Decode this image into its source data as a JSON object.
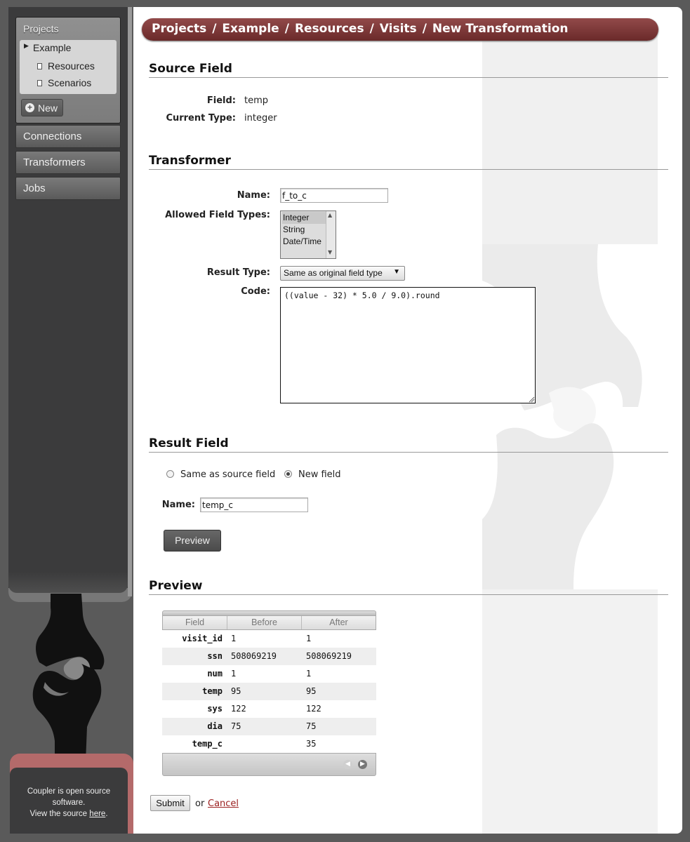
{
  "sidebar": {
    "projects_heading": "Projects",
    "tree": {
      "project": "Example",
      "children": [
        "Resources",
        "Scenarios"
      ]
    },
    "new_button": "New",
    "nav": [
      "Connections",
      "Transformers",
      "Jobs"
    ]
  },
  "footer": {
    "line1": "Coupler is open source",
    "line2": "software.",
    "line3_prefix": "View the source",
    "link": "here",
    "line3_suffix": "."
  },
  "breadcrumb": [
    "Projects",
    "Example",
    "Resources",
    "Visits",
    "New Transformation"
  ],
  "breadcrumb_separator": "/",
  "source_field": {
    "title": "Source Field",
    "field_label": "Field:",
    "field_value": "temp",
    "type_label": "Current Type:",
    "type_value": "integer"
  },
  "transformer": {
    "title": "Transformer",
    "name_label": "Name:",
    "name_value": "f_to_c",
    "allowed_label": "Allowed Field Types:",
    "allowed_options": [
      "Integer",
      "String",
      "Date/Time"
    ],
    "result_type_label": "Result Type:",
    "result_type_value": "Same as original field type",
    "code_label": "Code:",
    "code_value": "((value - 32) * 5.0 / 9.0).round"
  },
  "result_field": {
    "title": "Result Field",
    "radio_same": "Same as source field",
    "radio_new": "New field",
    "selected": "New field",
    "name_label": "Name:",
    "name_value": "temp_c",
    "preview_button": "Preview"
  },
  "preview": {
    "title": "Preview",
    "columns": [
      "Field",
      "Before",
      "After"
    ],
    "rows": [
      {
        "field": "visit_id",
        "before": "1",
        "after": "1"
      },
      {
        "field": "ssn",
        "before": "508069219",
        "after": "508069219"
      },
      {
        "field": "num",
        "before": "1",
        "after": "1"
      },
      {
        "field": "temp",
        "before": "95",
        "after": "95"
      },
      {
        "field": "sys",
        "before": "122",
        "after": "122"
      },
      {
        "field": "dia",
        "before": "75",
        "after": "75"
      },
      {
        "field": "temp_c",
        "before": "",
        "after": "35"
      }
    ]
  },
  "actions": {
    "submit": "Submit",
    "or": "or",
    "cancel": "Cancel"
  },
  "colors": {
    "accent": "#7a3535",
    "sidebar_bg": "#3b3b3c",
    "cancel_link": "#9b2020"
  }
}
